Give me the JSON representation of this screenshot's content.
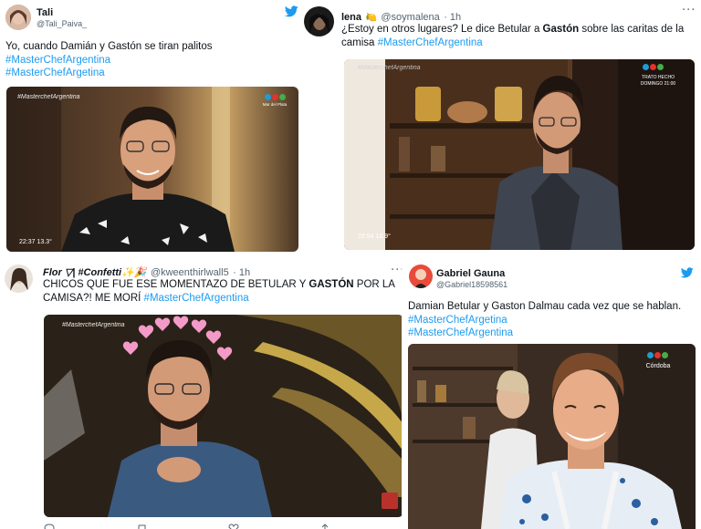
{
  "tweets": [
    {
      "name": "Tali",
      "handle": "@Tali_Paiva_",
      "lines": [
        "Yo, cuando Damián y Gastón se tiran palitos"
      ],
      "hashtags": [
        "#MasterChefArgentina",
        "#MasterChefArgetina"
      ],
      "media": {
        "watermark": "#MasterchefArgentina",
        "timestamp": "22:37  13.3°",
        "logo_caption": "Mar del Plata"
      }
    },
    {
      "name": "lena",
      "name_emoji": "🍋",
      "handle": "@soymalena",
      "time": "· 1h",
      "text_a": "¿Estoy en otros lugares? Le dice Betular a ",
      "text_bold": "Gastón",
      "text_b": " sobre las caritas de la",
      "text_c": "camisa",
      "hashtag": "#MasterChefArgentina",
      "media": {
        "watermark": "#MasterchefArgentina",
        "timestamp": "22:54   16.9°",
        "promo_line1": "TRATO HECHO",
        "promo_line2": "DOMINGO 21:00"
      }
    },
    {
      "name": "Flor ▽| #Confetti✨🎉",
      "handle": "@kweenthirlwall5",
      "time": "· 1h",
      "text_a": "CHICOS QUE FUE ESE MOMENTAZO DE BETULAR Y ",
      "text_bold": "GASTÓN",
      "text_b": " POR LA",
      "text_c": "CAMISA?! ME MORÍ ",
      "hashtag": "#MasterChefArgentina",
      "media": {
        "watermark": "#MasterchefArgentina"
      }
    },
    {
      "name": "Gabriel Gauna",
      "handle": "@Gabriel18598561",
      "lines": [
        "Damian Betular y Gaston Dalmau cada vez que se hablan."
      ],
      "hashtags": [
        "#MasterChefArgetina",
        "#MasterChefArgentina"
      ],
      "media": {
        "logo_caption": "Córdoba"
      }
    }
  ],
  "icons": {
    "brand": "twitter-bird-icon",
    "more": "more-options-icon"
  },
  "colors": {
    "twitter_blue": "#1d9bf0",
    "text": "#0f1419",
    "secondary": "#536471"
  }
}
